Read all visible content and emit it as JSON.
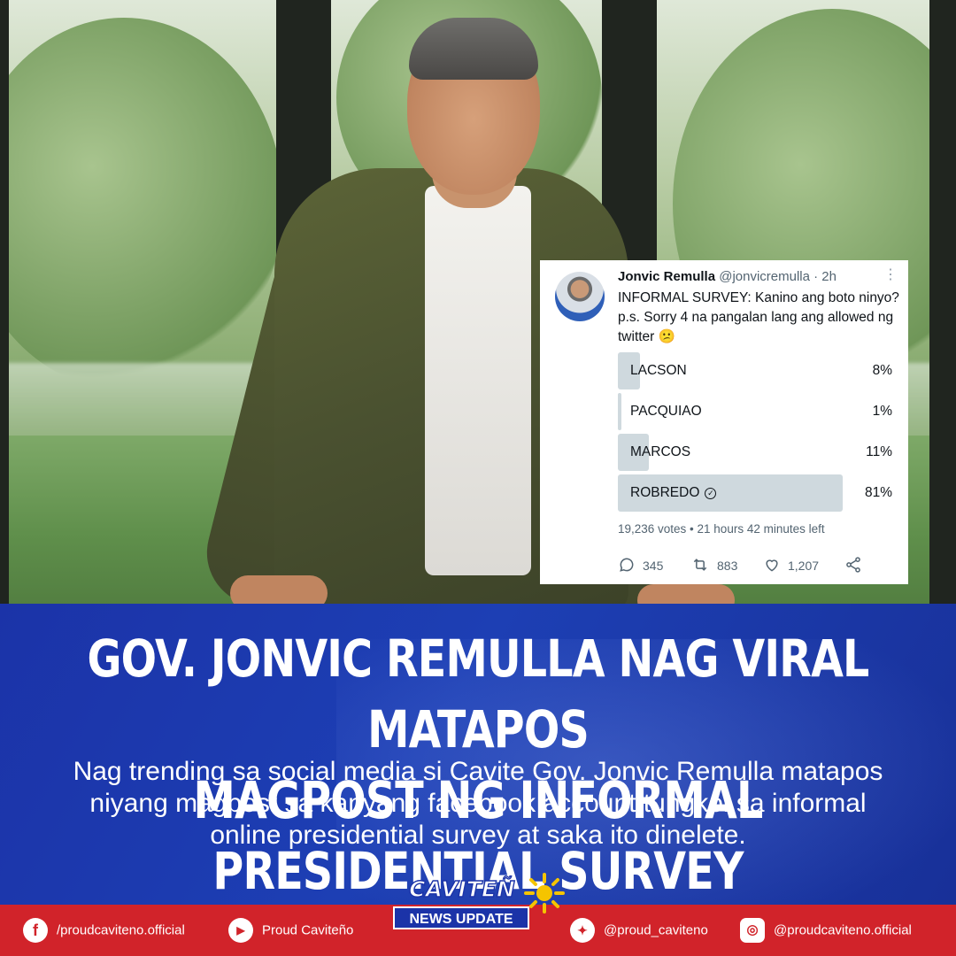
{
  "tweet": {
    "name": "Jonvic Remulla",
    "handle": "@jonvicremulla · 2h",
    "text": "INFORMAL SURVEY: Kanino ang boto ninyo? p.s. Sorry 4 na pangalan lang ang allowed ng twitter 😕",
    "poll": [
      {
        "label": "LACSON",
        "percent": "8%",
        "value": 8
      },
      {
        "label": "PACQUIAO",
        "percent": "1%",
        "value": 1
      },
      {
        "label": "MARCOS",
        "percent": "11%",
        "value": 11
      },
      {
        "label": "ROBREDO",
        "percent": "81%",
        "value": 81,
        "winner": true
      }
    ],
    "meta": "19,236 votes • 21 hours 42 minutes left",
    "replies": "345",
    "retweets": "883",
    "likes": "1,207"
  },
  "headline": {
    "line1": "GOV. JONVIC REMULLA NAG VIRAL MATAPOS",
    "line2": "MAGPOST NG INFORMAL PRESIDENTIAL SURVEY"
  },
  "subtext": {
    "line1": "Nag trending sa social media si Cavite Gov. Jonvic Remulla matapos",
    "line2": "niyang magpost sa kanyang facebook account tungkol sa informal",
    "line3": "online presidential survey at saka ito dinelete."
  },
  "logo": {
    "word": "CAVITEÑ",
    "sub": "NEWS UPDATE"
  },
  "footer": {
    "facebook": "/proudcaviteno.official",
    "youtube": "Proud Caviteño",
    "twitter": "@proud_caviteno",
    "instagram": "@proudcaviteno.official"
  },
  "colors": {
    "band": "#1d3fb4",
    "footer": "#d1232a"
  }
}
